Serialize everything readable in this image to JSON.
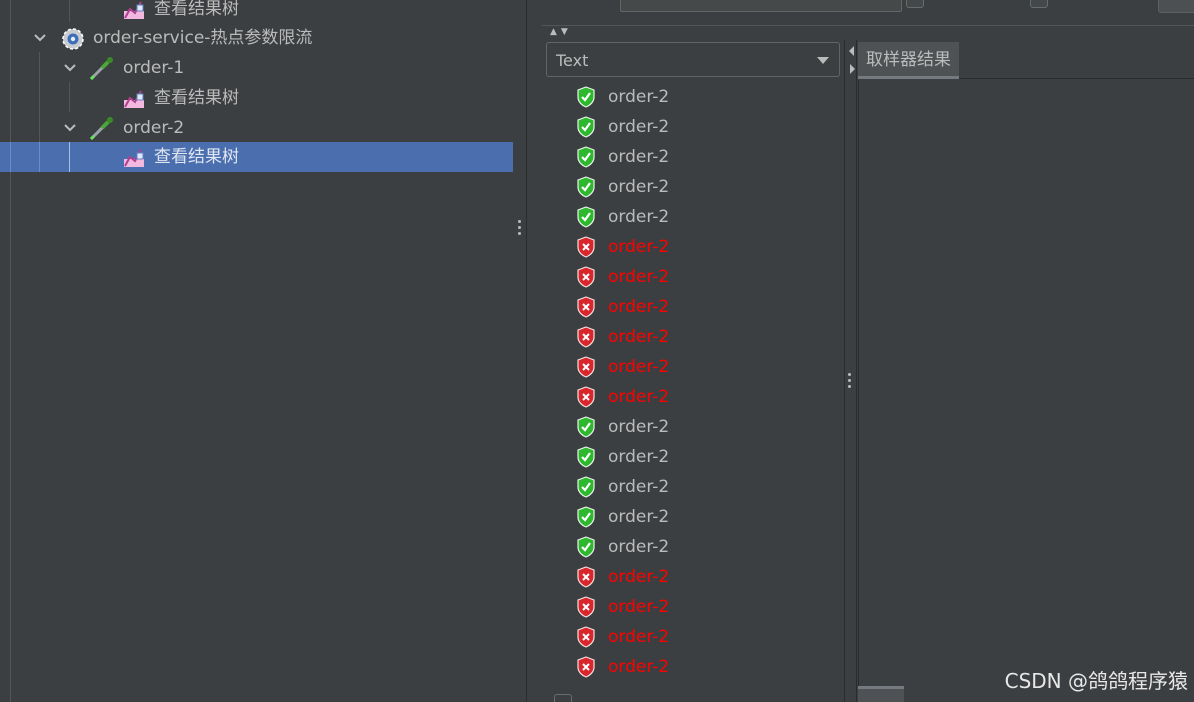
{
  "tree": {
    "items": [
      {
        "label": "查看结果树",
        "kind": "listener",
        "level": 3,
        "selected": false
      },
      {
        "label": "order-service-热点参数限流",
        "kind": "thread-group",
        "level": 1,
        "expanded": true,
        "selected": false
      },
      {
        "label": "order-1",
        "kind": "sampler",
        "level": 2,
        "expanded": true,
        "selected": false
      },
      {
        "label": "查看结果树",
        "kind": "listener",
        "level": 3,
        "selected": false
      },
      {
        "label": "order-2",
        "kind": "sampler",
        "level": 2,
        "expanded": true,
        "selected": false
      },
      {
        "label": "查看结果树",
        "kind": "listener",
        "level": 3,
        "selected": true
      }
    ]
  },
  "results": {
    "renderer_select": {
      "value": "Text"
    },
    "samples": [
      {
        "label": "order-2",
        "status": "success"
      },
      {
        "label": "order-2",
        "status": "success"
      },
      {
        "label": "order-2",
        "status": "success"
      },
      {
        "label": "order-2",
        "status": "success"
      },
      {
        "label": "order-2",
        "status": "success"
      },
      {
        "label": "order-2",
        "status": "error"
      },
      {
        "label": "order-2",
        "status": "error"
      },
      {
        "label": "order-2",
        "status": "error"
      },
      {
        "label": "order-2",
        "status": "error"
      },
      {
        "label": "order-2",
        "status": "error"
      },
      {
        "label": "order-2",
        "status": "error"
      },
      {
        "label": "order-2",
        "status": "success"
      },
      {
        "label": "order-2",
        "status": "success"
      },
      {
        "label": "order-2",
        "status": "success"
      },
      {
        "label": "order-2",
        "status": "success"
      },
      {
        "label": "order-2",
        "status": "success"
      },
      {
        "label": "order-2",
        "status": "error"
      },
      {
        "label": "order-2",
        "status": "error"
      },
      {
        "label": "order-2",
        "status": "error"
      },
      {
        "label": "order-2",
        "status": "error"
      }
    ],
    "detail_tab": "取样器结果"
  },
  "colors": {
    "background": "#3c3f41",
    "selection": "#4b6eaf",
    "text": "#bbbbbb",
    "error_text": "#ff0000",
    "success_icon": "#2eb82e",
    "error_icon": "#d9262c"
  },
  "watermark": "CSDN @鸽鸽程序猿"
}
